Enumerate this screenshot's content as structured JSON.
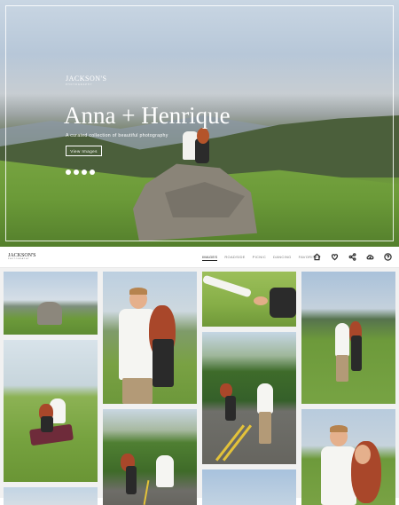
{
  "hero": {
    "logo": "JACKSON'S",
    "logo_sub": "PHOTOGRAPHY",
    "title": "Anna + Henrique",
    "subtitle": "A curated collection of beautiful photography",
    "button_label": "View Images",
    "social_icons": [
      "facebook-icon",
      "twitter-icon",
      "pinterest-icon",
      "email-icon"
    ]
  },
  "nav": {
    "logo": "JACKSON'S",
    "logo_sub": "PHOTOGRAPHY",
    "tabs": [
      {
        "label": "IMAGES",
        "active": true
      },
      {
        "label": "ROADSIDE",
        "active": false
      },
      {
        "label": "PICNIC",
        "active": false
      },
      {
        "label": "DANCING",
        "active": false
      },
      {
        "label": "FAVORITES",
        "active": false
      }
    ],
    "icons": [
      "home-icon",
      "heart-icon",
      "share-icon",
      "download-icon",
      "help-icon"
    ]
  },
  "colors": {
    "accent": "#222222",
    "background": "#ffffff",
    "gallery_bg": "#f1f1f1"
  }
}
